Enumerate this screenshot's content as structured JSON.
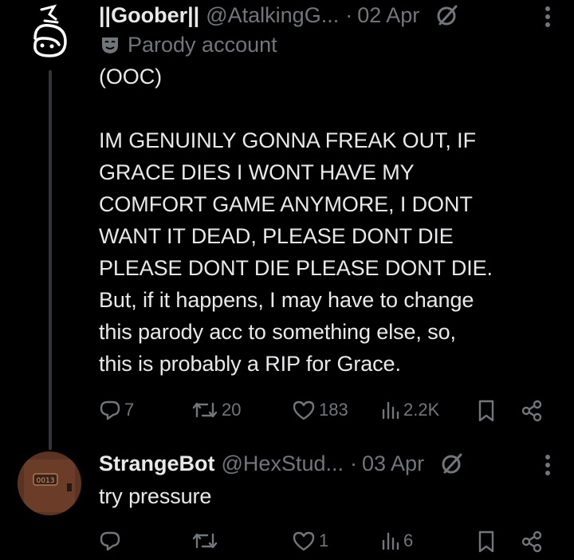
{
  "posts": [
    {
      "display_name": "||Goober||",
      "handle": "@AtalkingG...",
      "separator": "·",
      "date": "02 Apr",
      "badge_label": "Parody account",
      "text": "(OOC)\n\nIM GENUINLY GONNA FREAK OUT, IF\nGRACE DIES I WONT HAVE MY\nCOMFORT GAME ANYMORE, I DONT\nWANT IT DEAD, PLEASE DONT DIE\nPLEASE DONT DIE PLEASE DONT DIE.\nBut, if it happens, I may have to change\nthis parody acc to something else, so,\nthis is probably a RIP for Grace.",
      "replies": "7",
      "reposts": "20",
      "likes": "183",
      "views": "2.2K"
    },
    {
      "display_name": "StrangeBot",
      "handle": "@HexStud...",
      "separator": "·",
      "date": "03 Apr",
      "text": "try pressure",
      "replies": "",
      "reposts": "",
      "likes": "1",
      "views": "6",
      "avatar_label": "0013"
    }
  ],
  "icons": [
    "grok-icon",
    "more-icon",
    "mask-icon",
    "reply-icon",
    "repost-icon",
    "like-icon",
    "views-icon",
    "bookmark-icon",
    "share-icon"
  ],
  "colors": {
    "background": "#000000",
    "text": "#e7e9ea",
    "muted": "#71767b",
    "thread_line": "#333639"
  }
}
